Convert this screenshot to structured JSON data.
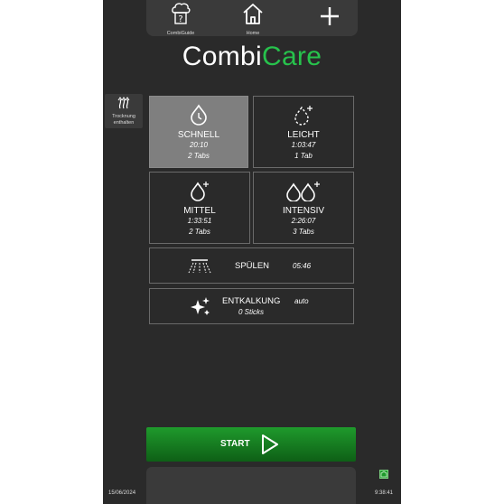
{
  "nav": {
    "combiguide_label": "CombiGuide",
    "home_label": "Home"
  },
  "brand": {
    "part1": "Combi",
    "part2": "Care"
  },
  "drying": {
    "line1": "Trocknung",
    "line2": "enthalten"
  },
  "programs": [
    {
      "name": "SCHNELL",
      "duration": "20:10",
      "tabs": "2 Tabs",
      "selected": true
    },
    {
      "name": "LEICHT",
      "duration": "1:03:47",
      "tabs": "1 Tab",
      "selected": false
    },
    {
      "name": "MITTEL",
      "duration": "1:33:51",
      "tabs": "2 Tabs",
      "selected": false
    },
    {
      "name": "INTENSIV",
      "duration": "2:26:07",
      "tabs": "3 Tabs",
      "selected": false
    }
  ],
  "rinse": {
    "label": "SPÜLEN",
    "duration": "05:46"
  },
  "descale": {
    "label": "ENTKALKUNG",
    "mode": "auto",
    "sticks": "0 Sticks"
  },
  "start": {
    "label": "START"
  },
  "footer": {
    "date": "15/06/2024",
    "time": "9:38:41"
  },
  "colors": {
    "brand_accent": "#27c24c",
    "start_green": "#1f9a2c",
    "background": "#2a2a2a",
    "selected_tile": "#7f7f7f"
  }
}
